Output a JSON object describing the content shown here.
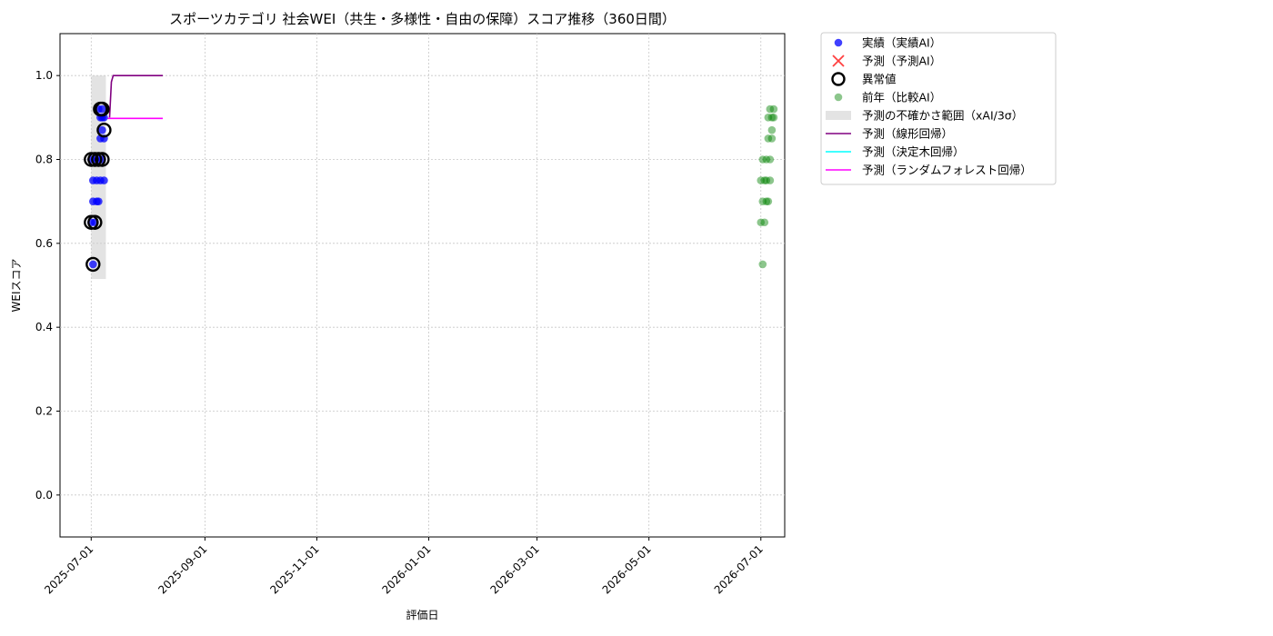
{
  "chart_data": {
    "type": "scatter",
    "title": "スポーツカテゴリ 社会WEI（共生・多様性・自由の保障）スコア推移（360日間）",
    "xlabel": "評価日",
    "ylabel": "WEIスコア",
    "ylim": [
      -0.1,
      1.1
    ],
    "xlim": [
      "2025-06-14",
      "2026-07-14"
    ],
    "yticks": [
      0.0,
      0.2,
      0.4,
      0.6,
      0.8,
      1.0
    ],
    "ytick_labels": [
      "0.0",
      "0.2",
      "0.4",
      "0.6",
      "0.8",
      "1.0"
    ],
    "xticks": [
      "2025-07-01",
      "2025-09-01",
      "2025-11-01",
      "2026-01-01",
      "2026-03-01",
      "2026-05-01",
      "2026-07-01"
    ],
    "grid": true,
    "legend_position": "outside-top-right",
    "legend": [
      {
        "label": "実績（実績AI）",
        "kind": "dot",
        "color": "#0000ff"
      },
      {
        "label": "予測（予測AI）",
        "kind": "cross",
        "color": "#ff0000"
      },
      {
        "label": "異常値",
        "kind": "ring",
        "color": "#000000"
      },
      {
        "label": "前年（比較AI）",
        "kind": "dot-light",
        "color": "#008000"
      },
      {
        "label": "予測の不確かさ範囲（xAI/3σ）",
        "kind": "band",
        "color": "#cccccc"
      },
      {
        "label": "予測（線形回帰）",
        "kind": "line",
        "color": "#800080"
      },
      {
        "label": "予測（決定木回帰）",
        "kind": "line",
        "color": "#00ffff"
      },
      {
        "label": "予測（ランダムフォレスト回帰）",
        "kind": "line",
        "color": "#ff00ff"
      }
    ],
    "series": [
      {
        "name": "実績（実績AI）",
        "color": "#0000ff",
        "points": [
          {
            "x": "2025-07-01",
            "y": 0.65
          },
          {
            "x": "2025-07-01",
            "y": 0.8
          },
          {
            "x": "2025-07-02",
            "y": 0.75
          },
          {
            "x": "2025-07-02",
            "y": 0.55
          },
          {
            "x": "2025-07-02",
            "y": 0.7
          },
          {
            "x": "2025-07-03",
            "y": 0.8
          },
          {
            "x": "2025-07-03",
            "y": 0.65
          },
          {
            "x": "2025-07-04",
            "y": 0.75
          },
          {
            "x": "2025-07-04",
            "y": 0.7
          },
          {
            "x": "2025-07-05",
            "y": 0.8
          },
          {
            "x": "2025-07-05",
            "y": 0.92
          },
          {
            "x": "2025-07-05",
            "y": 0.7
          },
          {
            "x": "2025-07-06",
            "y": 0.85
          },
          {
            "x": "2025-07-06",
            "y": 0.9
          },
          {
            "x": "2025-07-06",
            "y": 0.75
          },
          {
            "x": "2025-07-07",
            "y": 0.87
          },
          {
            "x": "2025-07-07",
            "y": 0.92
          },
          {
            "x": "2025-07-07",
            "y": 0.8
          },
          {
            "x": "2025-07-07",
            "y": 0.9
          },
          {
            "x": "2025-07-08",
            "y": 0.85
          },
          {
            "x": "2025-07-08",
            "y": 0.9
          },
          {
            "x": "2025-07-08",
            "y": 0.75
          }
        ]
      },
      {
        "name": "異常値",
        "color": "#000000",
        "points": [
          {
            "x": "2025-07-01",
            "y": 0.65
          },
          {
            "x": "2025-07-01",
            "y": 0.8
          },
          {
            "x": "2025-07-02",
            "y": 0.55
          },
          {
            "x": "2025-07-03",
            "y": 0.65
          },
          {
            "x": "2025-07-03",
            "y": 0.8
          },
          {
            "x": "2025-07-05",
            "y": 0.8
          },
          {
            "x": "2025-07-06",
            "y": 0.92
          },
          {
            "x": "2025-07-07",
            "y": 0.92
          },
          {
            "x": "2025-07-07",
            "y": 0.8
          },
          {
            "x": "2025-07-08",
            "y": 0.87
          }
        ]
      },
      {
        "name": "前年（比較AI）",
        "color": "#008000",
        "points": [
          {
            "x": "2026-07-01",
            "y": 0.75
          },
          {
            "x": "2026-07-01",
            "y": 0.65
          },
          {
            "x": "2026-07-02",
            "y": 0.7
          },
          {
            "x": "2026-07-02",
            "y": 0.55
          },
          {
            "x": "2026-07-02",
            "y": 0.8
          },
          {
            "x": "2026-07-03",
            "y": 0.75
          },
          {
            "x": "2026-07-03",
            "y": 0.65
          },
          {
            "x": "2026-07-04",
            "y": 0.7
          },
          {
            "x": "2026-07-04",
            "y": 0.75
          },
          {
            "x": "2026-07-04",
            "y": 0.8
          },
          {
            "x": "2026-07-05",
            "y": 0.7
          },
          {
            "x": "2026-07-05",
            "y": 0.85
          },
          {
            "x": "2026-07-05",
            "y": 0.9
          },
          {
            "x": "2026-07-06",
            "y": 0.92
          },
          {
            "x": "2026-07-06",
            "y": 0.75
          },
          {
            "x": "2026-07-06",
            "y": 0.8
          },
          {
            "x": "2026-07-07",
            "y": 0.87
          },
          {
            "x": "2026-07-07",
            "y": 0.85
          },
          {
            "x": "2026-07-07",
            "y": 0.9
          },
          {
            "x": "2026-07-08",
            "y": 0.92
          },
          {
            "x": "2026-07-08",
            "y": 0.9
          }
        ]
      }
    ],
    "band": {
      "name": "予測の不確かさ範囲（xAI/3σ）",
      "color": "#cccccc",
      "x_start": "2025-07-01",
      "x_end": "2025-07-09",
      "y_low": 0.515,
      "y_high": 1.0
    },
    "lines": [
      {
        "name": "予測（線形回帰）",
        "color": "#800080",
        "points": [
          {
            "x": "2025-07-11",
            "y": 0.9
          },
          {
            "x": "2025-07-12",
            "y": 0.985
          },
          {
            "x": "2025-07-13",
            "y": 1.0
          },
          {
            "x": "2025-08-09",
            "y": 1.0
          }
        ]
      },
      {
        "name": "予測（ランダムフォレスト回帰）",
        "color": "#ff00ff",
        "points": [
          {
            "x": "2025-07-10",
            "y": 0.898
          },
          {
            "x": "2025-08-09",
            "y": 0.898
          }
        ]
      }
    ]
  }
}
